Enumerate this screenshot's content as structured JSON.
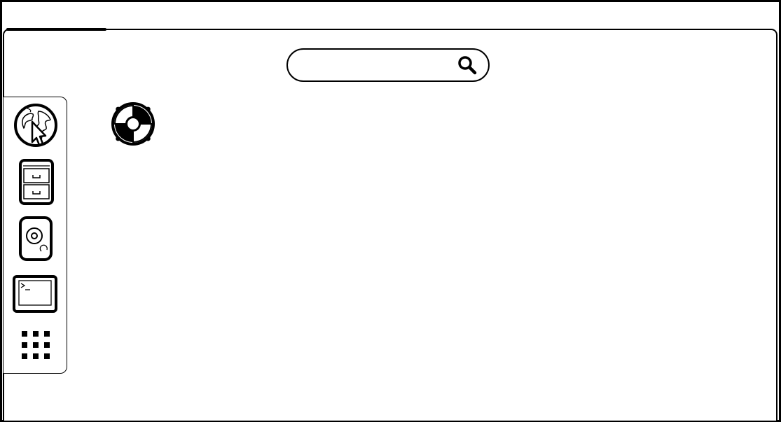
{
  "search": {
    "value": "",
    "placeholder": ""
  },
  "dock": {
    "items": [
      {
        "icon": "web-browser-icon"
      },
      {
        "icon": "file-cabinet-icon"
      },
      {
        "icon": "disk-drive-icon"
      },
      {
        "icon": "terminal-icon"
      },
      {
        "icon": "app-grid-icon"
      }
    ]
  },
  "desktop": {
    "icons": [
      {
        "icon": "help-lifebuoy-icon",
        "label": ""
      }
    ]
  },
  "colors": {
    "stroke": "#000000",
    "background": "#ffffff"
  }
}
